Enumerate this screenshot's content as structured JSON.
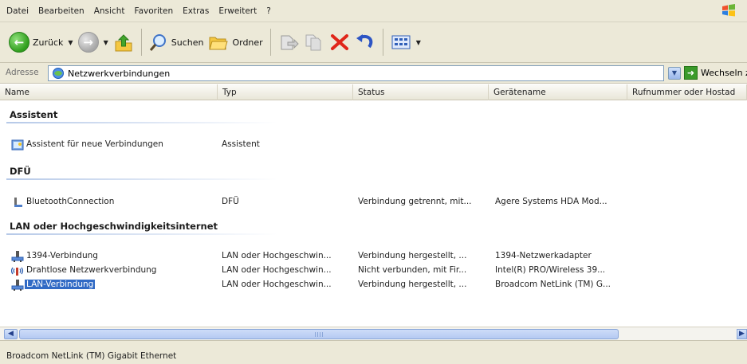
{
  "menu": [
    "Datei",
    "Bearbeiten",
    "Ansicht",
    "Favoriten",
    "Extras",
    "Erweitert",
    "?"
  ],
  "toolbar": {
    "back_label": "Zurück",
    "search_label": "Suchen",
    "folders_label": "Ordner"
  },
  "address": {
    "label": "Adresse",
    "value": "Netzwerkverbindungen",
    "go_label": "Wechseln zu"
  },
  "columns": [
    "Name",
    "Typ",
    "Status",
    "Gerätename",
    "Rufnummer oder Hostad"
  ],
  "groups": [
    {
      "title": "Assistent",
      "items": [
        {
          "name": "Assistent für neue Verbindungen",
          "type": "Assistent",
          "status": "",
          "device": "",
          "icon": "wizard-icon"
        }
      ]
    },
    {
      "title": "DFÜ",
      "items": [
        {
          "name": "BluetoothConnection",
          "type": "DFÜ",
          "status": "Verbindung getrennt, mit...",
          "device": "Agere Systems HDA Mod...",
          "icon": "dialup-connection-icon"
        }
      ]
    },
    {
      "title": "LAN oder Hochgeschwindigkeitsinternet",
      "items": [
        {
          "name": "1394-Verbindung",
          "type": "LAN oder Hochgeschwin...",
          "status": "Verbindung hergestellt, ...",
          "device": "1394-Netzwerkadapter",
          "icon": "lan-connection-icon"
        },
        {
          "name": "Drahtlose Netzwerkverbindung",
          "type": "LAN oder Hochgeschwin...",
          "status": "Nicht verbunden, mit Fir...",
          "device": "Intel(R) PRO/Wireless 39...",
          "icon": "wireless-connection-icon"
        },
        {
          "name": "LAN-Verbindung",
          "type": "LAN oder Hochgeschwin...",
          "status": "Verbindung hergestellt, ...",
          "device": "Broadcom NetLink (TM) G...",
          "icon": "lan-connection-icon",
          "selected": true
        }
      ]
    }
  ],
  "status_bar": "Broadcom NetLink (TM) Gigabit Ethernet",
  "colors": {
    "selection": "#316ac5",
    "chrome": "#ece9d8"
  }
}
